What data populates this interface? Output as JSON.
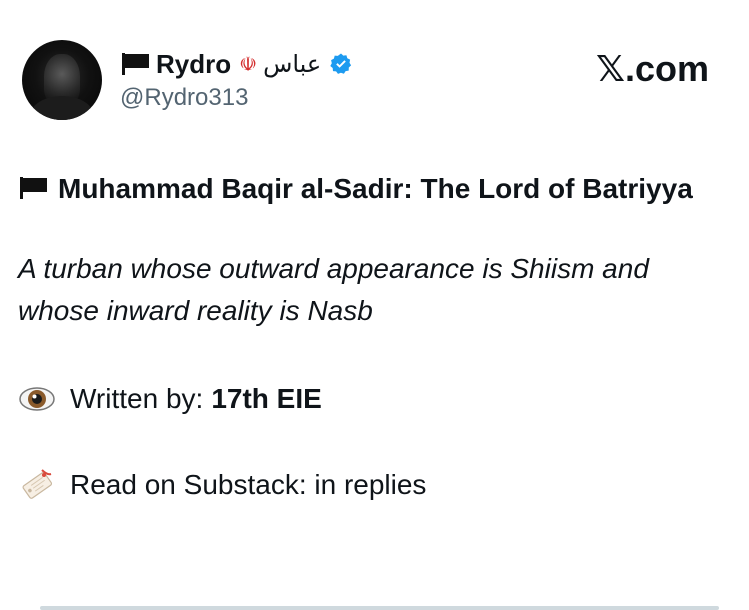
{
  "author": {
    "display_name": "Rydro",
    "arabic_name": "عباس",
    "handle": "@Rydro313",
    "verified_color": "#1d9bf0",
    "flag_icon": "black-flag-icon",
    "emblem_icon": "iran-emblem-icon"
  },
  "brand": {
    "label": ".com",
    "logo": "x-logo-icon"
  },
  "post": {
    "title": "Muhammad Baqir al-Sadir: The Lord of Batriyya",
    "quote": "A turban whose outward appearance is Shiism and whose inward reality is Nasb",
    "written_by_label": "Written by:",
    "written_by_value": "17th EIE",
    "read_on": "Read on Substack: in replies",
    "eye_icon": "eye-emoji-icon",
    "tag_icon": "label-tag-emoji-icon"
  }
}
